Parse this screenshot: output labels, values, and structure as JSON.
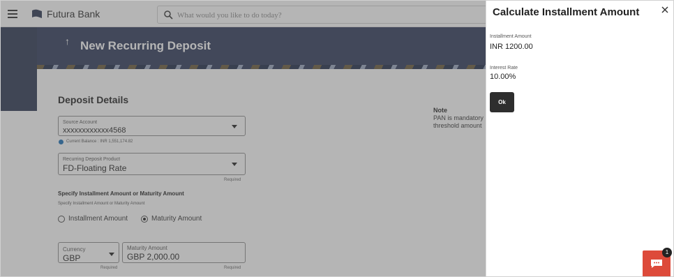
{
  "header": {
    "bank_name": "Futura Bank",
    "search_placeholder": "What would you like to do today?"
  },
  "page": {
    "title": "New Recurring Deposit",
    "back_arrow": "↑"
  },
  "form": {
    "section_title": "Deposit Details",
    "source_account": {
      "label": "Source Account",
      "value": "xxxxxxxxxxxx4568",
      "balance": "Current Balance : INR 1,551,174.82"
    },
    "product": {
      "label": "Recurring Deposit Product",
      "value": "FD-Floating Rate",
      "required": "Required"
    },
    "specify": {
      "heading": "Specify Installment Amount or Maturity Amount",
      "subtext": "Specify Installment Amount or Maturity Amount",
      "options": [
        "Installment Amount",
        "Maturity Amount"
      ],
      "selected": "Maturity Amount"
    },
    "currency": {
      "label": "Currency",
      "value": "GBP",
      "required": "Required"
    },
    "maturity_amount": {
      "label": "Maturity Amount",
      "value": "GBP 2,000.00",
      "required": "Required"
    }
  },
  "note": {
    "title": "Note",
    "line1": "PAN is mandatory",
    "line2": "threshold amount"
  },
  "panel": {
    "title": "Calculate Installment Amount",
    "installment_label": "Installment Amount",
    "installment_value": "INR 1200.00",
    "rate_label": "Interest Rate",
    "rate_value": "10.00%",
    "ok_label": "Ok"
  },
  "chat": {
    "badge_count": "1"
  },
  "colors": {
    "header_band": "#2f3a5a",
    "chat_button": "#dd4a3a",
    "info_icon": "#1a6fb6"
  }
}
